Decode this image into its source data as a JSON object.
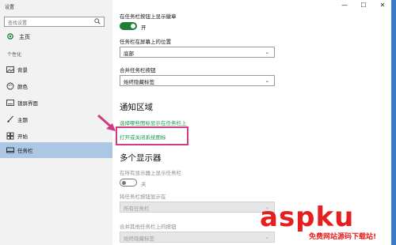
{
  "window": {
    "title": "设置",
    "minimize": "—",
    "maximize": "☐",
    "close": "✕"
  },
  "sidebar": {
    "search_placeholder": "查找设置",
    "home_label": "主页",
    "section_label": "个性化",
    "items": [
      {
        "label": "背景",
        "icon": "picture-icon"
      },
      {
        "label": "颜色",
        "icon": "palette-icon"
      },
      {
        "label": "锁屏界面",
        "icon": "lock-screen-icon"
      },
      {
        "label": "主题",
        "icon": "brush-icon"
      },
      {
        "label": "开始",
        "icon": "start-icon"
      },
      {
        "label": "任务栏",
        "icon": "taskbar-icon",
        "active": true
      }
    ]
  },
  "content": {
    "badges_label": "在任务栏按钮上显示徽章",
    "badges_toggle": "开",
    "position_label": "任务栏在屏幕上的位置",
    "position_value": "底部",
    "combine_label": "合并任务栏按钮",
    "combine_value": "始终隐藏标签",
    "notify_heading": "通知区域",
    "notify_link1": "选择哪些图标显示在任务栏上",
    "notify_link2": "打开或关闭系统图标",
    "multi_heading": "多个显示器",
    "multi_show_label": "在所有显示器上显示任务栏",
    "multi_toggle": "关",
    "multi_buttons_label": "将任务栏按钮显示在",
    "multi_buttons_value": "所有任务栏",
    "multi_combine_label": "合并其他任务栏上的按钮",
    "multi_combine_value": "始终隐藏标签"
  },
  "watermark": {
    "brand": "aspku",
    "tagline": "免费网站源码下载站!"
  },
  "colors": {
    "accent": "#1e7e34",
    "link": "#1a9c4c",
    "highlight": "#d23a86",
    "active_nav": "#acc7e3"
  }
}
